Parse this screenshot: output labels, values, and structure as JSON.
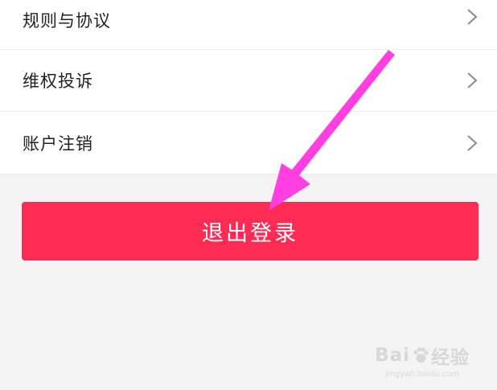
{
  "menu": {
    "items": [
      {
        "label": "规则与协议",
        "icon": "chevron-right-icon"
      },
      {
        "label": "维权投诉",
        "icon": "chevron-right-icon"
      },
      {
        "label": "账户注销",
        "icon": "chevron-right-icon"
      }
    ]
  },
  "logout": {
    "label": "退出登录",
    "color": "#fe2c55"
  },
  "annotation": {
    "color": "#ff3fe0",
    "shape": "arrow"
  },
  "watermark": {
    "brand": "Bai",
    "brand_suffix": "经验",
    "url": "jingyan.baidu.com"
  }
}
